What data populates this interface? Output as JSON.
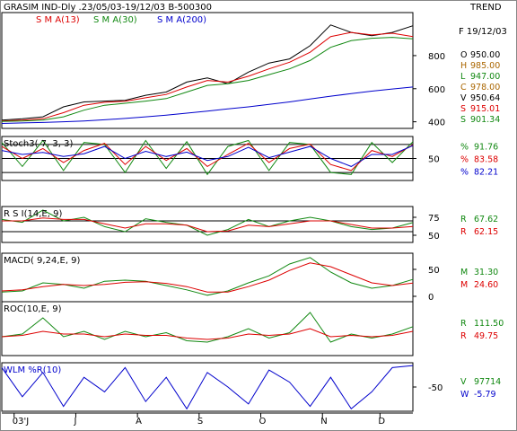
{
  "header": {
    "title": "GRASIM IND-Dly .23/05/03-19/12/03  B-500300",
    "trend_label": "TREND",
    "date": "F 19/12/03"
  },
  "colors": {
    "frame": "#000000",
    "price": "#000000",
    "sma13": "#dd0000",
    "sma30": "#118811",
    "sma200": "#0000cc",
    "stoch_k": "#118811",
    "stoch_d": "#dd0000",
    "stoch_slow": "#0000cc",
    "rsi": "#118811",
    "rsi_avg": "#dd0000",
    "macd": "#118811",
    "macd_signal": "#dd0000",
    "roc": "#118811",
    "roc_avg": "#dd0000",
    "wlm": "#0000cc",
    "text_green": "#118811",
    "text_red": "#dd0000",
    "text_blue": "#0000cc",
    "text_brown": "#aa6600",
    "text_black": "#000000"
  },
  "x_axis": {
    "labels": [
      "03'J",
      "J",
      "A",
      "S",
      "O",
      "N",
      "D"
    ],
    "label_months": [
      "Jun",
      "Jul",
      "Aug",
      "Sep",
      "Oct",
      "Nov",
      "Dec"
    ],
    "month_start_fractions": [
      0.03,
      0.18,
      0.33,
      0.48,
      0.63,
      0.78,
      0.92
    ]
  },
  "chart_data": [
    {
      "type": "line",
      "panel": "price",
      "legend": [
        {
          "name": "S M A(13)",
          "color": "#dd0000"
        },
        {
          "name": "S M A(30)",
          "color": "#118811"
        },
        {
          "name": "S M A(200)",
          "color": "#0000cc"
        }
      ],
      "ylim": [
        360,
        1060
      ],
      "yticks": [
        400,
        600,
        800
      ],
      "ohlc_summary": [
        {
          "label": "O",
          "value": "950.00",
          "color": "#000000"
        },
        {
          "label": "H",
          "value": "985.00",
          "color": "#aa6600"
        },
        {
          "label": "L",
          "value": "947.00",
          "color": "#118811"
        },
        {
          "label": "C",
          "value": "978.00",
          "color": "#aa6600"
        },
        {
          "label": "V",
          "value": "950.64",
          "color": "#000000"
        },
        {
          "label": "S",
          "value": "915.01",
          "color": "#dd0000"
        },
        {
          "label": "S",
          "value": "901.34",
          "color": "#118811"
        }
      ],
      "x": [
        0,
        0.05,
        0.1,
        0.15,
        0.2,
        0.25,
        0.3,
        0.35,
        0.4,
        0.45,
        0.5,
        0.55,
        0.6,
        0.65,
        0.7,
        0.75,
        0.8,
        0.85,
        0.9,
        0.95,
        1.0
      ],
      "series": [
        {
          "name": "price",
          "values": [
            410,
            418,
            430,
            490,
            520,
            525,
            530,
            560,
            580,
            640,
            665,
            630,
            700,
            755,
            780,
            860,
            985,
            940,
            920,
            940,
            980
          ]
        },
        {
          "name": "S M A(13)",
          "values": [
            405,
            410,
            418,
            455,
            500,
            518,
            524,
            545,
            565,
            610,
            650,
            640,
            675,
            720,
            760,
            820,
            915,
            940,
            925,
            935,
            915
          ]
        },
        {
          "name": "S M A(30)",
          "values": [
            402,
            405,
            410,
            430,
            470,
            500,
            512,
            525,
            540,
            580,
            620,
            630,
            650,
            685,
            720,
            770,
            850,
            890,
            905,
            910,
            901
          ]
        },
        {
          "name": "S M A(200)",
          "values": [
            390,
            393,
            396,
            400,
            405,
            412,
            420,
            430,
            440,
            452,
            465,
            478,
            490,
            505,
            520,
            538,
            555,
            570,
            585,
            598,
            610
          ]
        }
      ]
    },
    {
      "type": "line",
      "panel": "stochastic",
      "title": "Stoch3( 7, 3, 3)",
      "ylim": [
        -5,
        105
      ],
      "yticks": [
        50
      ],
      "reference_lines": [
        85,
        50,
        15
      ],
      "readings": [
        {
          "label": "%",
          "value": "91.76",
          "color": "#118811"
        },
        {
          "label": "%",
          "value": "83.58",
          "color": "#dd0000"
        },
        {
          "label": "%",
          "value": "82.21",
          "color": "#0000cc"
        }
      ],
      "x": [
        0,
        0.05,
        0.1,
        0.15,
        0.2,
        0.25,
        0.3,
        0.35,
        0.4,
        0.45,
        0.5,
        0.55,
        0.6,
        0.65,
        0.7,
        0.75,
        0.8,
        0.85,
        0.9,
        0.95,
        1.0
      ],
      "series": [
        {
          "values": [
            90,
            30,
            95,
            20,
            90,
            85,
            15,
            95,
            25,
            92,
            10,
            80,
            95,
            20,
            90,
            85,
            15,
            10,
            90,
            40,
            92
          ]
        },
        {
          "values": [
            80,
            50,
            75,
            40,
            70,
            88,
            35,
            80,
            45,
            75,
            30,
            60,
            88,
            40,
            75,
            86,
            35,
            20,
            70,
            55,
            84
          ]
        },
        {
          "values": [
            70,
            60,
            65,
            55,
            62,
            80,
            50,
            68,
            55,
            66,
            45,
            55,
            78,
            52,
            66,
            80,
            50,
            30,
            60,
            60,
            82
          ]
        }
      ]
    },
    {
      "type": "line",
      "panel": "rsi",
      "title": "R S I(14,E, 9)",
      "ylim": [
        40,
        90
      ],
      "yticks": [
        75,
        50
      ],
      "reference_lines": [
        70,
        55
      ],
      "readings": [
        {
          "label": "R",
          "value": "67.62",
          "color": "#118811"
        },
        {
          "label": "R",
          "value": "62.15",
          "color": "#dd0000"
        }
      ],
      "x": [
        0,
        0.05,
        0.1,
        0.15,
        0.2,
        0.25,
        0.3,
        0.35,
        0.4,
        0.45,
        0.5,
        0.55,
        0.6,
        0.65,
        0.7,
        0.75,
        0.8,
        0.85,
        0.9,
        0.95,
        1.0
      ],
      "series": [
        {
          "values": [
            72,
            68,
            85,
            70,
            75,
            62,
            55,
            73,
            68,
            64,
            50,
            58,
            72,
            62,
            70,
            75,
            70,
            62,
            58,
            60,
            67.6
          ]
        },
        {
          "values": [
            70,
            70,
            74,
            72,
            72,
            66,
            60,
            66,
            66,
            64,
            55,
            56,
            64,
            62,
            66,
            70,
            70,
            65,
            60,
            60,
            62.2
          ]
        }
      ]
    },
    {
      "type": "line",
      "panel": "macd",
      "title": "MACD( 9,24,E, 9)",
      "ylim": [
        -10,
        80
      ],
      "yticks": [
        50,
        0
      ],
      "readings": [
        {
          "label": "M",
          "value": "31.30",
          "color": "#118811"
        },
        {
          "label": "M",
          "value": "24.60",
          "color": "#dd0000"
        }
      ],
      "x": [
        0,
        0.05,
        0.1,
        0.15,
        0.2,
        0.25,
        0.3,
        0.35,
        0.4,
        0.45,
        0.5,
        0.55,
        0.6,
        0.65,
        0.7,
        0.75,
        0.8,
        0.85,
        0.9,
        0.95,
        1.0
      ],
      "series": [
        {
          "values": [
            8,
            10,
            25,
            22,
            15,
            28,
            30,
            28,
            20,
            12,
            2,
            10,
            25,
            38,
            60,
            72,
            45,
            25,
            15,
            20,
            31.3
          ]
        },
        {
          "values": [
            10,
            12,
            18,
            22,
            20,
            22,
            26,
            27,
            24,
            18,
            8,
            8,
            18,
            30,
            48,
            62,
            55,
            40,
            25,
            20,
            24.6
          ]
        }
      ]
    },
    {
      "type": "line",
      "panel": "roc",
      "title": "ROC(10,E, 9)",
      "ylim": [
        90,
        130
      ],
      "yticks": [],
      "readings": [
        {
          "label": "R",
          "value": "111.50",
          "color": "#118811"
        },
        {
          "label": "R",
          "value": "49.75",
          "color": "#dd0000"
        }
      ],
      "x": [
        0,
        0.05,
        0.1,
        0.15,
        0.2,
        0.25,
        0.3,
        0.35,
        0.4,
        0.45,
        0.5,
        0.55,
        0.6,
        0.65,
        0.7,
        0.75,
        0.8,
        0.85,
        0.9,
        0.95,
        1.0
      ],
      "series": [
        {
          "values": [
            104,
            106,
            118,
            104,
            108,
            102,
            108,
            104,
            107,
            101,
            100,
            104,
            110,
            103,
            107,
            122,
            100,
            106,
            103,
            106,
            111.5
          ]
        },
        {
          "values": [
            104,
            105,
            108,
            106,
            106,
            104,
            106,
            105,
            105,
            103,
            102,
            103,
            106,
            105,
            106,
            110,
            104,
            105,
            104,
            105,
            108
          ]
        }
      ]
    },
    {
      "type": "line",
      "panel": "williams",
      "title": "WLM %R(10)",
      "ylim": [
        -100,
        0
      ],
      "yticks": [
        -50
      ],
      "readings": [
        {
          "label": "V",
          "value": "97714",
          "color": "#118811"
        },
        {
          "label": "W",
          "value": "-5.79",
          "color": "#0000cc"
        }
      ],
      "x": [
        0,
        0.05,
        0.1,
        0.15,
        0.2,
        0.25,
        0.3,
        0.35,
        0.4,
        0.45,
        0.5,
        0.55,
        0.6,
        0.65,
        0.7,
        0.75,
        0.8,
        0.85,
        0.9,
        0.95,
        1.0
      ],
      "series": [
        {
          "values": [
            -10,
            -70,
            -20,
            -90,
            -30,
            -60,
            -10,
            -80,
            -30,
            -95,
            -20,
            -50,
            -85,
            -15,
            -40,
            -90,
            -30,
            -95,
            -60,
            -10,
            -5.8
          ]
        }
      ]
    }
  ]
}
